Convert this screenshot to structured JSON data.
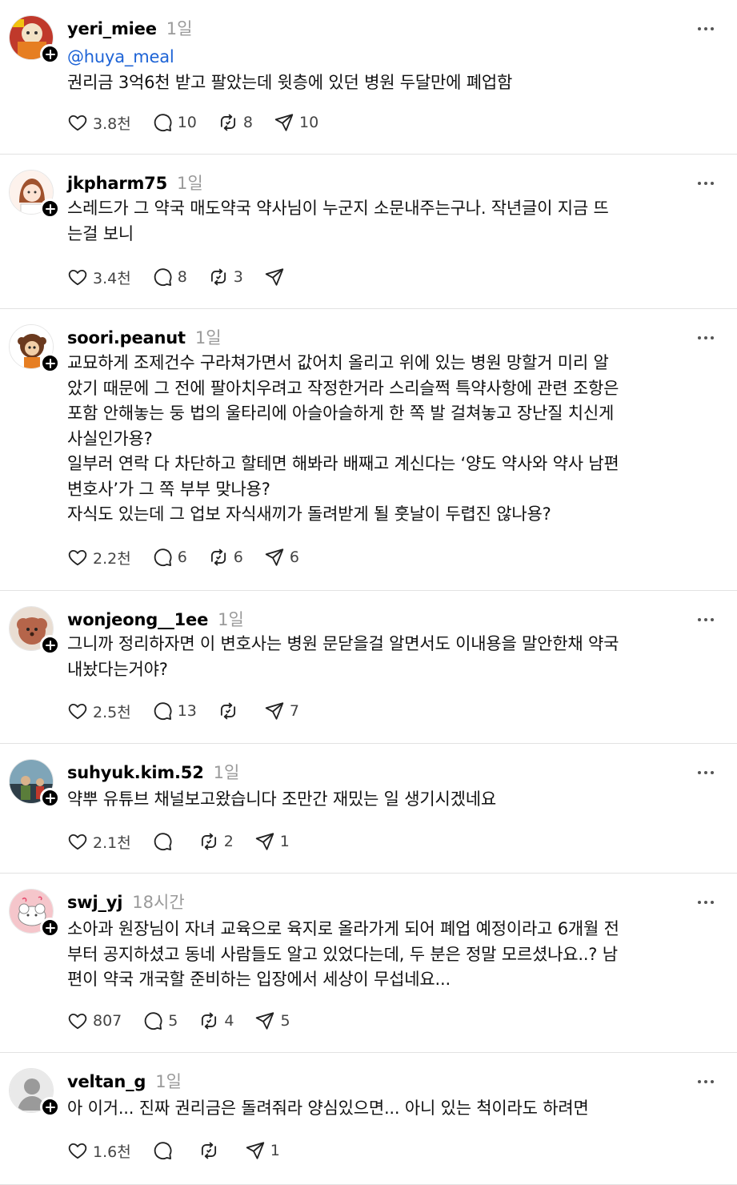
{
  "posts": [
    {
      "username": "yeri_miee",
      "time": "1일",
      "mention": "@huya_meal",
      "text": "권리금 3억6천 받고 팔았는데 윗층에 있던 병원 두달만에 폐업함",
      "likes": "3.8천",
      "replies": "10",
      "reposts": "8",
      "shares": "10",
      "avatar_colors": [
        "#c0392b",
        "#e67e22"
      ]
    },
    {
      "username": "jkpharm75",
      "time": "1일",
      "mention": "",
      "text": "스레드가 그 약국 매도약국 약사님이 누군지 소문내주는구나. 작년글이 지금 뜨\n는걸 보니",
      "likes": "3.4천",
      "replies": "8",
      "reposts": "3",
      "shares": "",
      "avatar_colors": [
        "#fdf2ec",
        "#a0522d"
      ]
    },
    {
      "username": "soori.peanut",
      "time": "1일",
      "mention": "",
      "text": "교묘하게 조제건수 구라쳐가면서 값어치 올리고 위에 있는 병원 망할거 미리 알\n았기 때문에 그 전에 팔아치우려고 작정한거라 스리슬쩍 특약사항에 관련 조항은\n포함 안해놓는 둥 법의 울타리에 아슬아슬하게 한 쪽 발 걸쳐놓고 장난질 치신게\n사실인가용?\n일부러 연락 다 차단하고 할테면 해봐라 배째고 계신다는 ‘양도 약사와 약사 남편\n변호사’가 그 쪽 부부 맞나용?\n자식도 있는데 그 업보 자식새끼가 돌려받게 될 훗날이 두렵진 않나용?",
      "likes": "2.2천",
      "replies": "6",
      "reposts": "6",
      "shares": "6",
      "avatar_colors": [
        "#ffffff",
        "#6b3a1f"
      ]
    },
    {
      "username": "wonjeong__1ee",
      "time": "1일",
      "mention": "",
      "text": "그니까 정리하자면 이 변호사는 병원 문닫을걸 알면서도 이내용을 말안한채 약국\n내놨다는거야?",
      "likes": "2.5천",
      "replies": "13",
      "reposts": "",
      "shares": "7",
      "avatar_colors": [
        "#e9ddd2",
        "#b5654a"
      ]
    },
    {
      "username": "suhyuk.kim.52",
      "time": "1일",
      "mention": "",
      "text": "약뿌 유튜브 채널보고왔습니다 조만간 재밌는 일 생기시겠네요",
      "likes": "2.1천",
      "replies": "",
      "reposts": "2",
      "shares": "1",
      "avatar_colors": [
        "#4a6a7a",
        "#2e3e48"
      ]
    },
    {
      "username": "swj_yj",
      "time": "18시간",
      "mention": "",
      "text": "소아과 원장님이 자녀 교육으로 육지로 올라가게 되어 폐업 예정이라고 6개월 전\n부터 공지하셨고 동네 사람들도 알고 있었다는데, 두 분은 정말 모르셨나요..? 남\n편이 약국 개국할 준비하는 입장에서 세상이 무섭네요...",
      "likes": "807",
      "replies": "5",
      "reposts": "4",
      "shares": "5",
      "avatar_colors": [
        "#f5c6cb",
        "#ffffff"
      ]
    },
    {
      "username": "veltan_g",
      "time": "1일",
      "mention": "",
      "text": "아 이거... 진짜 권리금은 돌려줘라 양심있으면... 아니 있는 척이라도 하려면",
      "likes": "1.6천",
      "replies": "",
      "reposts": "",
      "shares": "1",
      "avatar_colors": [
        "#e9e9e9",
        "#9a9a9a"
      ]
    }
  ],
  "icons": {
    "like": "heart-icon",
    "reply": "comment-icon",
    "repost": "repost-icon",
    "share": "send-icon",
    "more": "more-dots-icon",
    "follow": "plus-icon"
  }
}
